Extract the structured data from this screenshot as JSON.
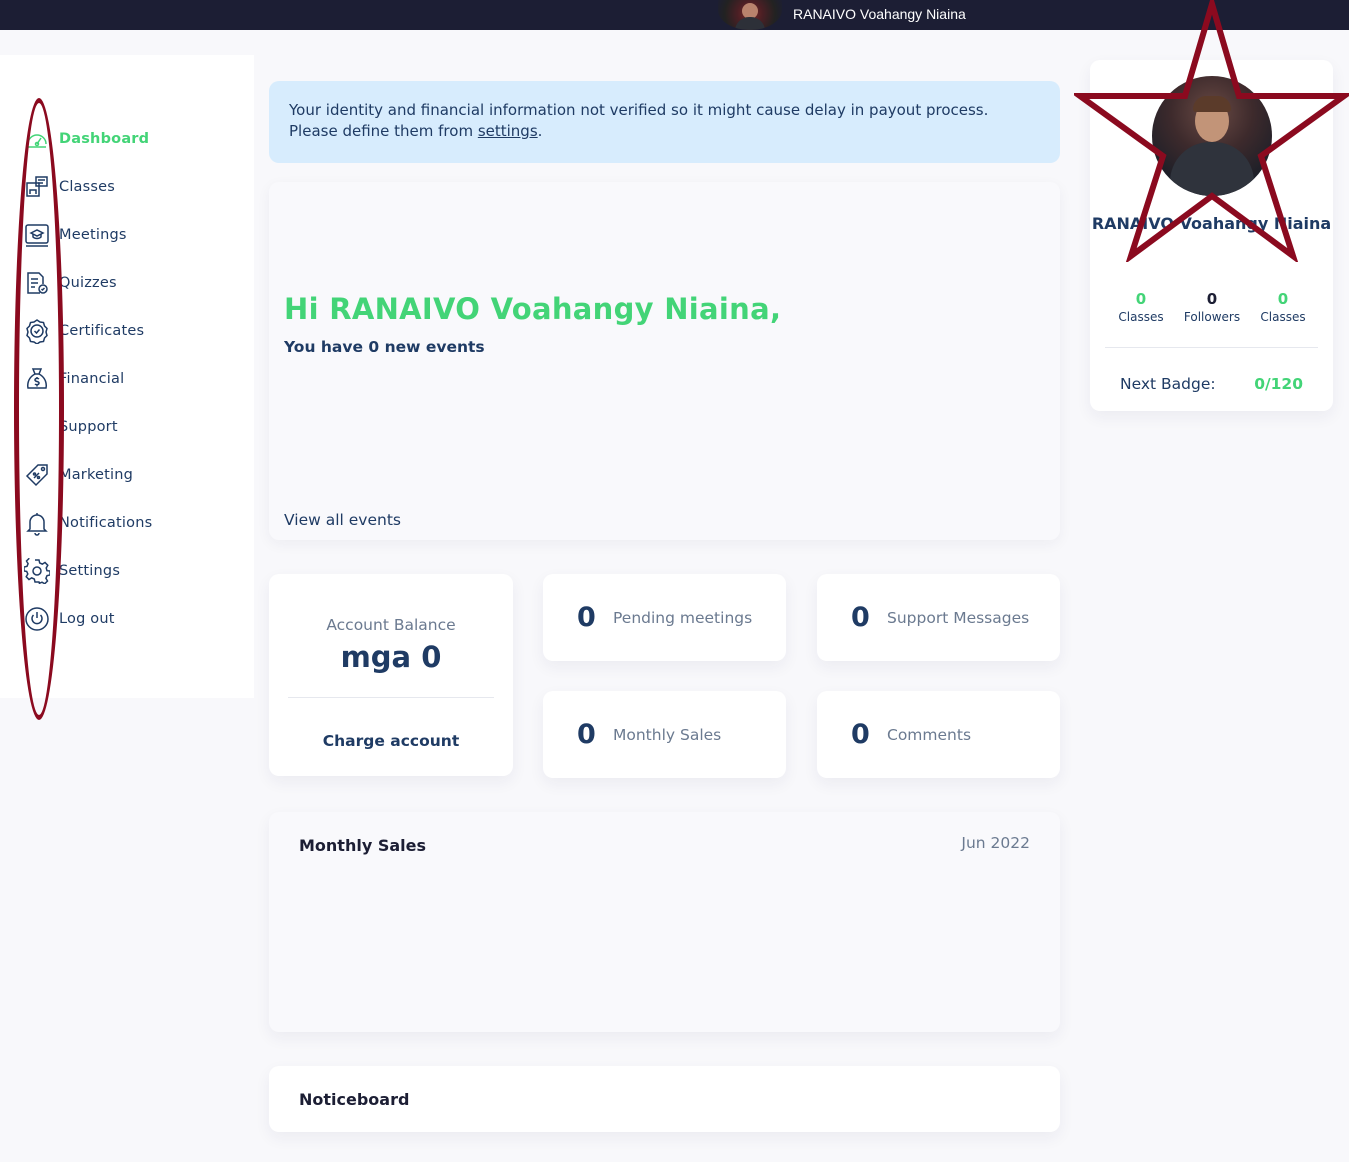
{
  "topbar": {
    "user_name": "RANAIVO Voahangy Niaina"
  },
  "sidebar": {
    "items": [
      {
        "label": "Dashboard",
        "icon": "dashboard-icon",
        "active": true
      },
      {
        "label": "Classes",
        "icon": "classes-icon"
      },
      {
        "label": "Meetings",
        "icon": "meetings-icon"
      },
      {
        "label": "Quizzes",
        "icon": "quizzes-icon"
      },
      {
        "label": "Certificates",
        "icon": "certificates-icon"
      },
      {
        "label": "Financial",
        "icon": "money-bag-icon"
      },
      {
        "label": "Support",
        "icon": "support-icon"
      },
      {
        "label": "Marketing",
        "icon": "price-tag-icon"
      },
      {
        "label": "Notifications",
        "icon": "bell-icon"
      },
      {
        "label": "Settings",
        "icon": "gear-icon"
      },
      {
        "label": "Log out",
        "icon": "power-icon"
      }
    ]
  },
  "alert": {
    "text_before": "Your identity and financial information not verified so it might cause delay in payout process. Please define them from ",
    "link": "settings",
    "text_after": "."
  },
  "hero": {
    "greeting": "Hi RANAIVO Voahangy Niaina,",
    "subtitle": "You have 0 new events",
    "view_all": "View all events"
  },
  "balance": {
    "label": "Account Balance",
    "value": "mga 0",
    "charge": "Charge account"
  },
  "stats": {
    "pending_meetings": {
      "value": "0",
      "label": "Pending meetings"
    },
    "support_messages": {
      "value": "0",
      "label": "Support Messages"
    },
    "monthly_sales": {
      "value": "0",
      "label": "Monthly Sales"
    },
    "comments": {
      "value": "0",
      "label": "Comments"
    }
  },
  "monthly_sales_section": {
    "title": "Monthly Sales",
    "date": "Jun 2022"
  },
  "noticeboard": {
    "title": "Noticeboard"
  },
  "profile": {
    "name": "RANAIVO Voahangy Niaina",
    "stats": [
      {
        "value": "0",
        "label": "Classes"
      },
      {
        "value": "0",
        "label": "Followers"
      },
      {
        "value": "0",
        "label": "Classes"
      }
    ],
    "badge_label": "Next Badge:",
    "badge_value": "0/120"
  },
  "colors": {
    "accent_green": "#43d477",
    "navy": "#1f3b64",
    "topbar": "#1c1e34",
    "alert_bg": "#d7ecfd",
    "annotation": "#8b0a1f"
  }
}
